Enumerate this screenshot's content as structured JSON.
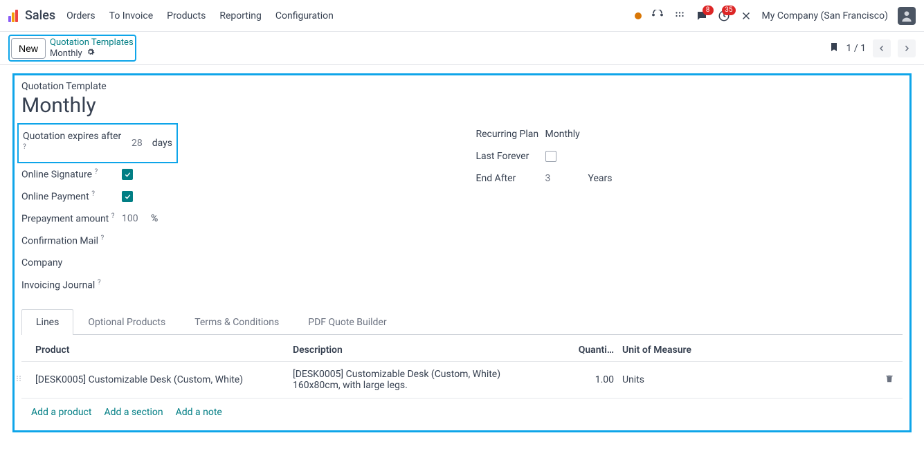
{
  "nav": {
    "brand": "Sales",
    "items": [
      "Orders",
      "To Invoice",
      "Products",
      "Reporting",
      "Configuration"
    ]
  },
  "header": {
    "chat_badge": "8",
    "activity_badge": "35",
    "company": "My Company (San Francisco)"
  },
  "subbar": {
    "new_btn": "New",
    "breadcrumb_parent": "Quotation Templates",
    "breadcrumb_current": "Monthly",
    "pager": "1 / 1"
  },
  "form": {
    "title_small": "Quotation Template",
    "title_big": "Monthly",
    "left": {
      "expires_label": "Quotation expires after",
      "expires_value": "28",
      "expires_unit": "days",
      "online_sig_label": "Online Signature",
      "online_pay_label": "Online Payment",
      "prepay_label": "Prepayment amount",
      "prepay_value": "100",
      "prepay_unit": "%",
      "confirm_mail_label": "Confirmation Mail",
      "company_label": "Company",
      "journal_label": "Invoicing Journal"
    },
    "right": {
      "plan_label": "Recurring Plan",
      "plan_value": "Monthly",
      "forever_label": "Last Forever",
      "end_after_label": "End After",
      "end_after_value": "3",
      "end_after_unit": "Years"
    }
  },
  "tabs": [
    "Lines",
    "Optional Products",
    "Terms & Conditions",
    "PDF Quote Builder"
  ],
  "table": {
    "headers": {
      "product": "Product",
      "description": "Description",
      "quantity": "Quanti…",
      "uom": "Unit of Measure"
    },
    "row": {
      "product": "[DESK0005] Customizable Desk (Custom, White)",
      "description": "[DESK0005] Customizable Desk (Custom, White)\n160x80cm, with large legs.",
      "quantity": "1.00",
      "uom": "Units"
    },
    "add_product": "Add a product",
    "add_section": "Add a section",
    "add_note": "Add a note"
  }
}
